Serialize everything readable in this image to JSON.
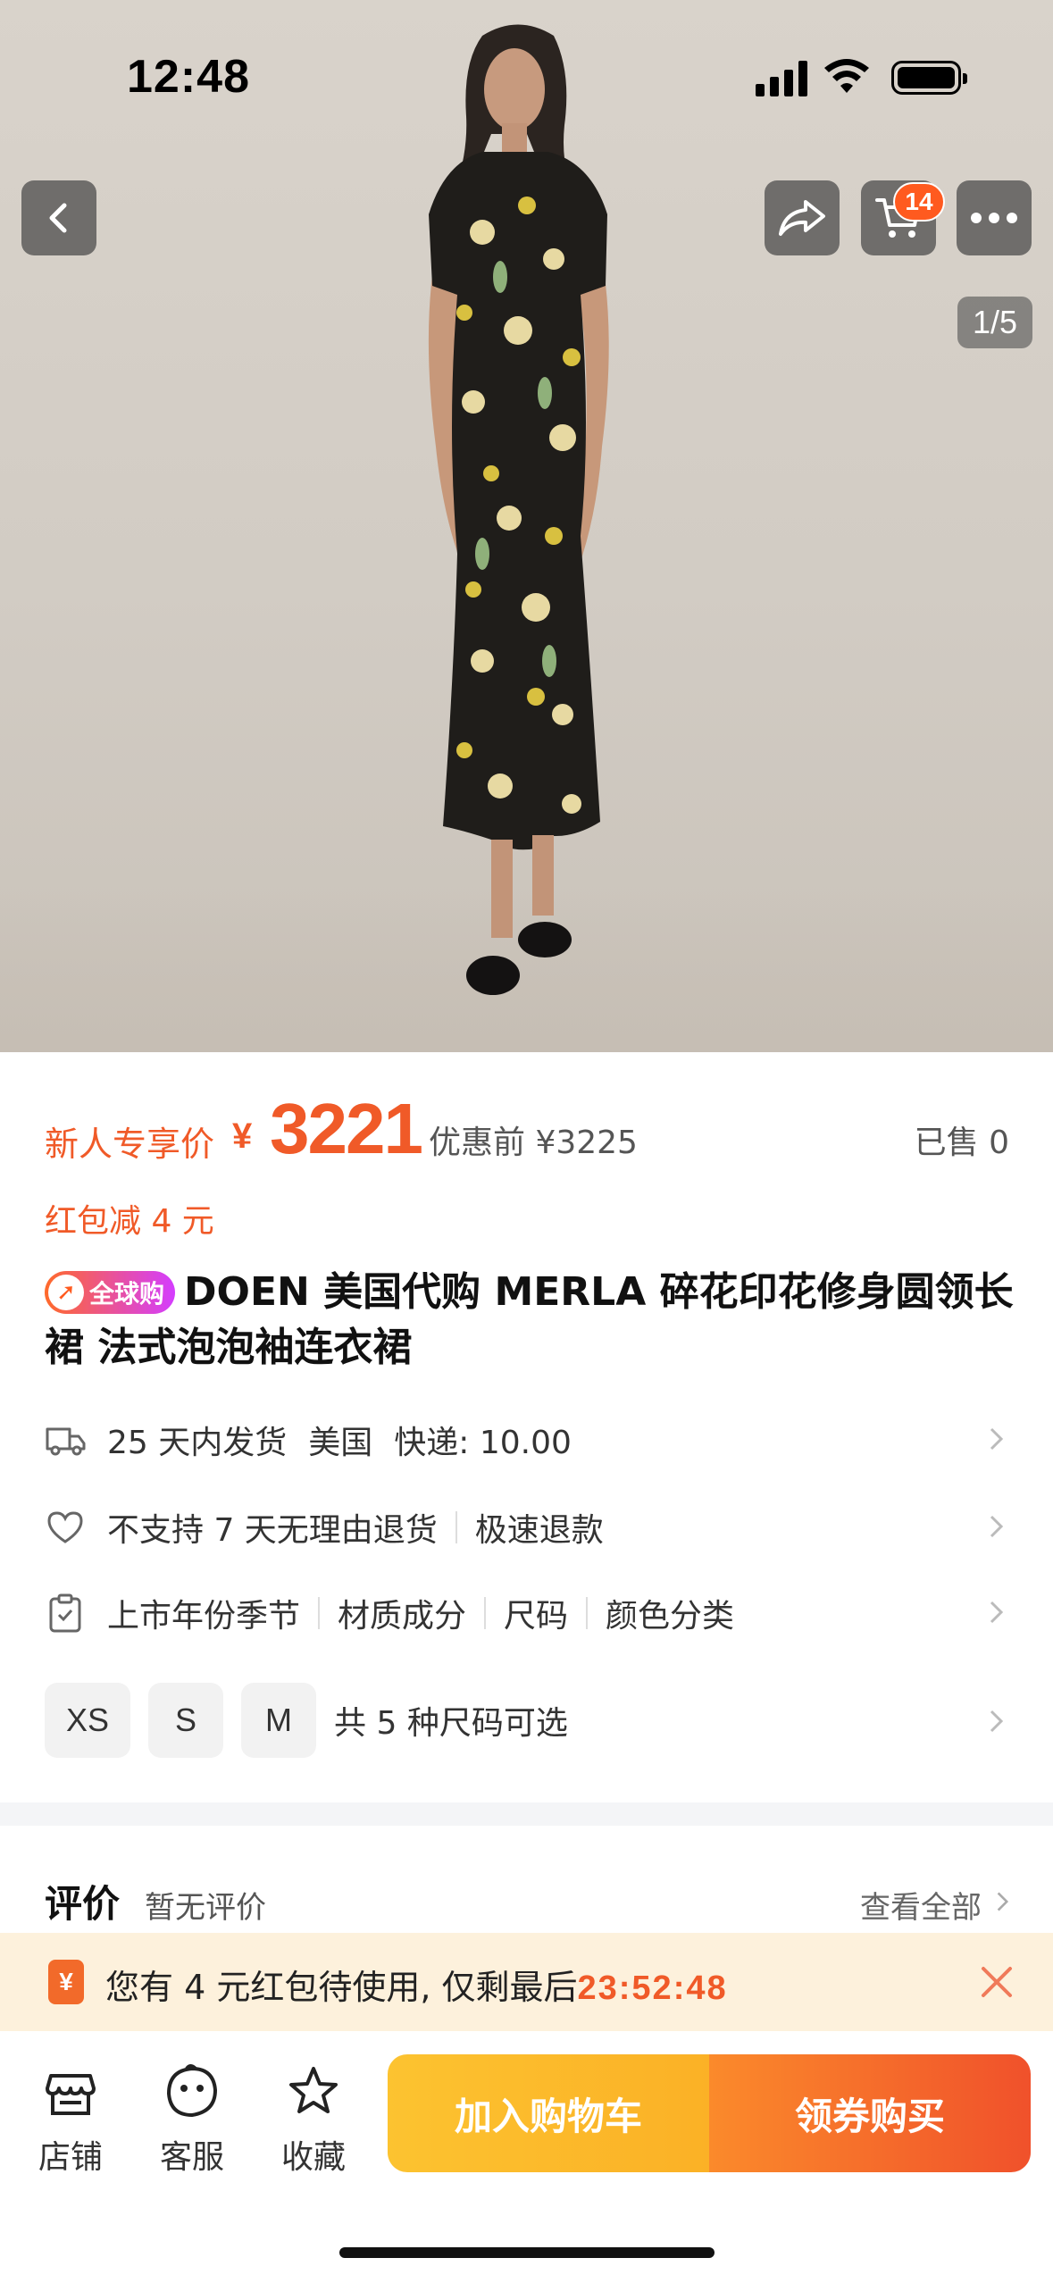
{
  "status_bar": {
    "time": "12:48"
  },
  "header": {
    "cart_count": "14",
    "image_index": "1/5"
  },
  "price": {
    "label": "新人专享价",
    "currency": "¥",
    "value": "3221",
    "original": "优惠前 ¥3225",
    "sold": "已售 0",
    "red_packet": "红包减 4 元"
  },
  "product": {
    "badge": "全球购",
    "title": "DOEN 美国代购 MERLA 碎花印花修身圆领长裙 法式泡泡袖连衣裙"
  },
  "shipping": {
    "ship_time": "25 天内发货",
    "origin": "美国",
    "express": "快递: 10.00"
  },
  "returns": {
    "policy": "不支持 7 天无理由退货",
    "refund": "极速退款"
  },
  "specs": {
    "items": [
      "上市年份季节",
      "材质成分",
      "尺码",
      "颜色分类"
    ]
  },
  "sizes": {
    "options": [
      "XS",
      "S",
      "M"
    ],
    "summary": "共 5 种尺码可选"
  },
  "reviews": {
    "title": "评价",
    "status": "暂无评价",
    "view_all": "查看全部"
  },
  "coupon_banner": {
    "text": "您有 4 元红包待使用, 仅剩最后",
    "timer": "23:52:48"
  },
  "bottom_bar": {
    "tabs": [
      {
        "label": "店铺"
      },
      {
        "label": "客服"
      },
      {
        "label": "收藏"
      }
    ],
    "add_to_cart": "加入购物车",
    "buy": "领券购买"
  },
  "colors": {
    "accent": "#f05a28",
    "cart_button": "#fbb126",
    "buy_button": "#f0512b",
    "banner_bg": "#fdf1dc"
  },
  "icons": [
    "back-icon",
    "share-icon",
    "cart-icon",
    "more-icon",
    "truck-icon",
    "heart-icon",
    "clipboard-icon",
    "chevron-right-icon",
    "red-packet-icon",
    "close-icon",
    "store-icon",
    "service-icon",
    "star-icon"
  ]
}
